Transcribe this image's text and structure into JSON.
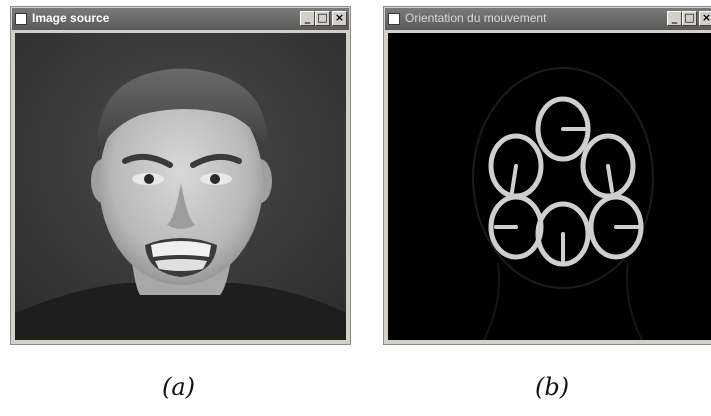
{
  "window_a": {
    "title": "Image source",
    "controls": {
      "minimize": "_",
      "maximize": "□",
      "close": "×"
    }
  },
  "window_b": {
    "title": "Orientation du mouvement",
    "controls": {
      "minimize": "_",
      "maximize": "□",
      "close": "×"
    }
  },
  "captions": {
    "a": "(a)",
    "b": "(b)"
  },
  "colors": {
    "titlebar": "#5a5a5a",
    "window_frame": "#d4d0c8",
    "orientation_circle": "#cfcfcf",
    "orientation_background": "#000000"
  },
  "icons": {
    "title_box": "window-icon",
    "min": "minimize-icon",
    "max": "maximize-icon",
    "close": "close-icon"
  }
}
